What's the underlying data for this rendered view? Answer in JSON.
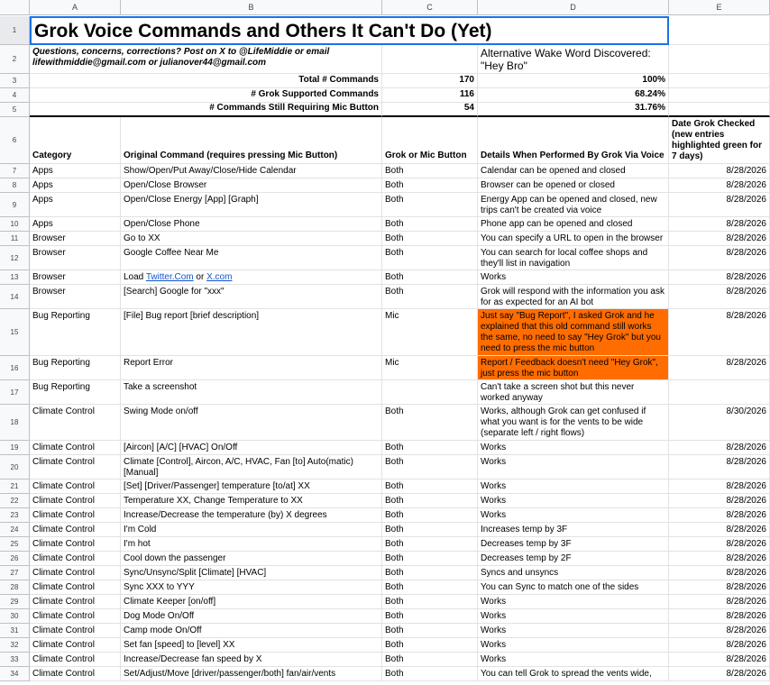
{
  "columns": [
    "A",
    "B",
    "C",
    "D",
    "E"
  ],
  "title": "Grok Voice Commands and Others It Can't Do (Yet)",
  "contact": "Questions, concerns, corrections? Post on X to @LifeMiddie or email lifewithmiddie@gmail.com or julianover44@gmail.com",
  "wake_word": "Alternative Wake Word Discovered: \"Hey Bro\"",
  "summary": [
    {
      "row": "3",
      "label": "Total # Commands",
      "count": "170",
      "pct": "100%"
    },
    {
      "row": "4",
      "label": "# Grok Supported Commands",
      "count": "116",
      "pct": "68.24%"
    },
    {
      "row": "5",
      "label": "# Commands Still Requiring Mic Button",
      "count": "54",
      "pct": "31.76%"
    }
  ],
  "headers": {
    "row": "6",
    "category": "Category",
    "original": "Original Command (requires pressing Mic Button)",
    "mode": "Grok or Mic Button",
    "details": "Details When Performed By Grok Via Voice",
    "date": "Date Grok Checked (new entries highlighted green for 7 days)"
  },
  "rows": [
    {
      "n": "7",
      "cat": "Apps",
      "cmd": "Show/Open/Put Away/Close/Hide Calendar",
      "mode": "Both",
      "det": "Calendar can be opened and closed",
      "date": "8/28/2026"
    },
    {
      "n": "8",
      "cat": "Apps",
      "cmd": "Open/Close Browser",
      "mode": "Both",
      "det": "Browser can be opened or closed",
      "date": "8/28/2026"
    },
    {
      "n": "9",
      "cat": "Apps",
      "cmd": "Open/Close Energy [App] [Graph]",
      "mode": "Both",
      "det": "Energy App can be opened and closed, new trips can't be created via voice",
      "date": "8/28/2026"
    },
    {
      "n": "10",
      "cat": "Apps",
      "cmd": "Open/Close Phone",
      "mode": "Both",
      "det": "Phone app can be opened and closed",
      "date": "8/28/2026"
    },
    {
      "n": "11",
      "cat": "Browser",
      "cmd": "Go to XX",
      "mode": "Both",
      "det": "You can specify a URL to open in the browser",
      "date": "8/28/2026"
    },
    {
      "n": "12",
      "cat": "Browser",
      "cmd": "Google Coffee Near Me",
      "mode": "Both",
      "det": "You can search for local coffee shops and they'll list in navigation",
      "date": "8/28/2026"
    },
    {
      "n": "13",
      "cat": "Browser",
      "cmd_pre": "Load ",
      "cmd_link1": "Twitter.Com",
      "cmd_mid": " or ",
      "cmd_link2": "X.com",
      "mode": "Both",
      "det": "Works",
      "date": "8/28/2026"
    },
    {
      "n": "14",
      "cat": "Browser",
      "cmd": "[Search] Google for \"xxx\"",
      "mode": "Both",
      "det": "Grok will respond with the information you ask for as expected for an AI bot",
      "date": "8/28/2026"
    },
    {
      "n": "15",
      "cat": "Bug Reporting",
      "cmd": "[File] Bug report [brief description]",
      "mode": "Mic",
      "det": "Just say \"Bug Report\", I asked Grok and he explained that this old command still works the same, no need to say \"Hey Grok\" but you need to press the mic button",
      "date": "8/28/2026",
      "hl": true
    },
    {
      "n": "16",
      "cat": "Bug Reporting",
      "cmd": "Report Error",
      "mode": "Mic",
      "det": "Report / Feedback  doesn't need \"Hey Grok\", just press the mic button",
      "date": "8/28/2026",
      "hl": true
    },
    {
      "n": "17",
      "cat": "Bug Reporting",
      "cmd": "Take a screenshot",
      "mode": "",
      "det": "Can't take a screen shot but this never worked anyway",
      "date": ""
    },
    {
      "n": "18",
      "cat": "Climate Control",
      "cmd": "Swing Mode on/off",
      "mode": "Both",
      "det": "Works, although Grok can get confused if what you want is for the vents to be wide (separate left / right flows)",
      "date": "8/30/2026"
    },
    {
      "n": "19",
      "cat": "Climate Control",
      "cmd": "[Aircon] [A/C] [HVAC] On/Off",
      "mode": "Both",
      "det": "Works",
      "date": "8/28/2026"
    },
    {
      "n": "20",
      "cat": "Climate Control",
      "cmd": "Climate [Control], Aircon, A/C, HVAC, Fan [to] Auto(matic) [Manual]",
      "mode": "Both",
      "det": "Works",
      "date": "8/28/2026"
    },
    {
      "n": "21",
      "cat": "Climate Control",
      "cmd": "[Set] [Driver/Passenger] temperature [to/at] XX",
      "mode": "Both",
      "det": "Works",
      "date": "8/28/2026"
    },
    {
      "n": "22",
      "cat": "Climate Control",
      "cmd": "Temperature XX, Change Temperature to XX",
      "mode": "Both",
      "det": "Works",
      "date": "8/28/2026"
    },
    {
      "n": "23",
      "cat": "Climate Control",
      "cmd": "Increase/Decrease the temperature (by) X degrees",
      "mode": "Both",
      "det": "Works",
      "date": "8/28/2026"
    },
    {
      "n": "24",
      "cat": "Climate Control",
      "cmd": "I'm Cold",
      "mode": "Both",
      "det": "Increases temp by 3F",
      "date": "8/28/2026"
    },
    {
      "n": "25",
      "cat": "Climate Control",
      "cmd": "I'm hot",
      "mode": "Both",
      "det": "Decreases temp by 3F",
      "date": "8/28/2026"
    },
    {
      "n": "26",
      "cat": "Climate Control",
      "cmd": "Cool down the passenger",
      "mode": "Both",
      "det": "Decreases temp by 2F",
      "date": "8/28/2026"
    },
    {
      "n": "27",
      "cat": "Climate Control",
      "cmd": "Sync/Unsync/Split [Climate] [HVAC]",
      "mode": "Both",
      "det": "Syncs and unsyncs",
      "date": "8/28/2026"
    },
    {
      "n": "28",
      "cat": "Climate Control",
      "cmd": "Sync XXX to YYY",
      "mode": "Both",
      "det": "You can Sync to match one of the sides",
      "date": "8/28/2026"
    },
    {
      "n": "29",
      "cat": "Climate Control",
      "cmd": "Climate Keeper [on/off]",
      "mode": "Both",
      "det": "Works",
      "date": "8/28/2026"
    },
    {
      "n": "30",
      "cat": "Climate Control",
      "cmd": "Dog Mode On/Off",
      "mode": "Both",
      "det": "Works",
      "date": "8/28/2026"
    },
    {
      "n": "31",
      "cat": "Climate Control",
      "cmd": "Camp mode On/Off",
      "mode": "Both",
      "det": "Works",
      "date": "8/28/2026"
    },
    {
      "n": "32",
      "cat": "Climate Control",
      "cmd": "Set fan [speed] to [level] XX",
      "mode": "Both",
      "det": "Works",
      "date": "8/28/2026"
    },
    {
      "n": "33",
      "cat": "Climate Control",
      "cmd": "Increase/Decrease fan speed by X",
      "mode": "Both",
      "det": "Works",
      "date": "8/28/2026"
    },
    {
      "n": "34",
      "cat": "Climate Control",
      "cmd": "Set/Adjust/Move [driver/passenger/both] fan/air/vents",
      "mode": "Both",
      "det": "You can tell Grok to spread the vents wide,",
      "date": "8/28/2026"
    }
  ],
  "colors": {
    "highlight": "#ff6d01",
    "link": "#1155cc",
    "header_bg": "#f8f9fa"
  }
}
